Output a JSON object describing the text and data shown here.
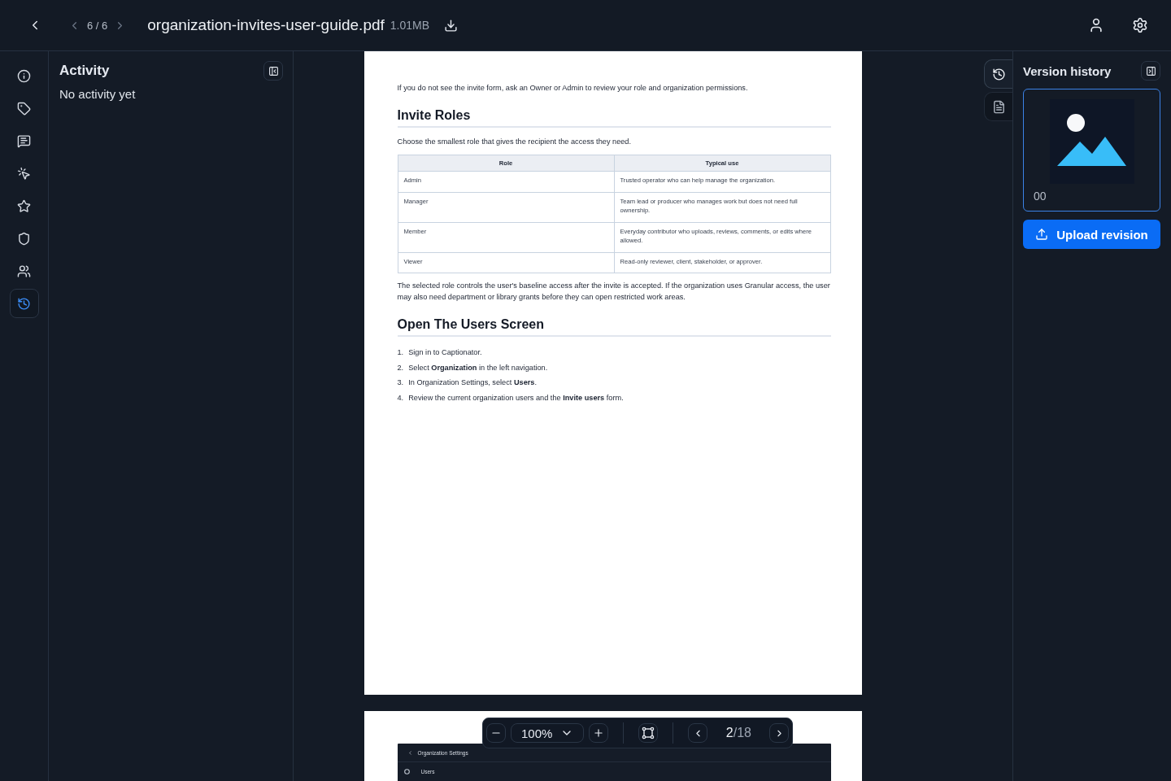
{
  "header": {
    "pager": "6 / 6",
    "file_name": "organization-invites-user-guide.pdf",
    "file_size": "1.01MB"
  },
  "rail": [
    {
      "kind": "info",
      "selected": false
    },
    {
      "kind": "tag",
      "selected": false
    },
    {
      "kind": "comment",
      "selected": false
    },
    {
      "kind": "click",
      "selected": false
    },
    {
      "kind": "star",
      "selected": false
    },
    {
      "kind": "shield",
      "selected": false
    },
    {
      "kind": "team",
      "selected": false
    },
    {
      "kind": "history",
      "selected": true
    }
  ],
  "activity_panel": {
    "title": "Activity",
    "empty_text": "No activity yet"
  },
  "document": {
    "pages": [
      {
        "blocks": [
          {
            "kind": "paragraph",
            "text": "If you do not see the invite form, ask an Owner or Admin to review your role and organization permissions."
          },
          {
            "kind": "heading",
            "text": "Invite Roles"
          },
          {
            "kind": "paragraph",
            "text": "Choose the smallest role that gives the recipient the access they need."
          },
          {
            "kind": "table",
            "columns": [
              "Role",
              "Typical use"
            ],
            "rows": [
              [
                "Admin",
                "Trusted operator who can help manage the organization."
              ],
              [
                "Manager",
                "Team lead or producer who manages work but does not need full ownership."
              ],
              [
                "Member",
                "Everyday contributor who uploads, reviews, comments, or edits where allowed."
              ],
              [
                "Viewer",
                "Read-only reviewer, client, stakeholder, or approver."
              ]
            ]
          },
          {
            "kind": "paragraph",
            "text": "The selected role controls the user's baseline access after the invite is accepted. If the organization uses Granular access, the user may also need department or library grants before they can open restricted work areas."
          },
          {
            "kind": "heading",
            "text": "Open The Users Screen"
          },
          {
            "kind": "list",
            "items": [
              {
                "number": "1.",
                "text": "Sign in to Captionator."
              },
              {
                "number": "2.",
                "text": "Select **Organization** in the left navigation."
              },
              {
                "number": "3.",
                "text": "In Organization Settings, select **Users**."
              },
              {
                "number": "4.",
                "text": "Review the current organization users and the **Invite users** form."
              }
            ]
          }
        ]
      },
      {
        "blocks": [
          {
            "kind": "screenshot",
            "title": "Organization Settings",
            "item": "Users"
          }
        ]
      }
    ]
  },
  "zoom_bar": {
    "zoom": "100%",
    "page_current": "2",
    "page_total": "/18"
  },
  "side_tabs": [
    {
      "kind": "history",
      "selected": true
    },
    {
      "kind": "file",
      "selected": false
    }
  ],
  "version_panel": {
    "title": "Version history",
    "versions": [
      {
        "label": "00",
        "selected": true
      }
    ],
    "upload_button": "Upload revision"
  }
}
